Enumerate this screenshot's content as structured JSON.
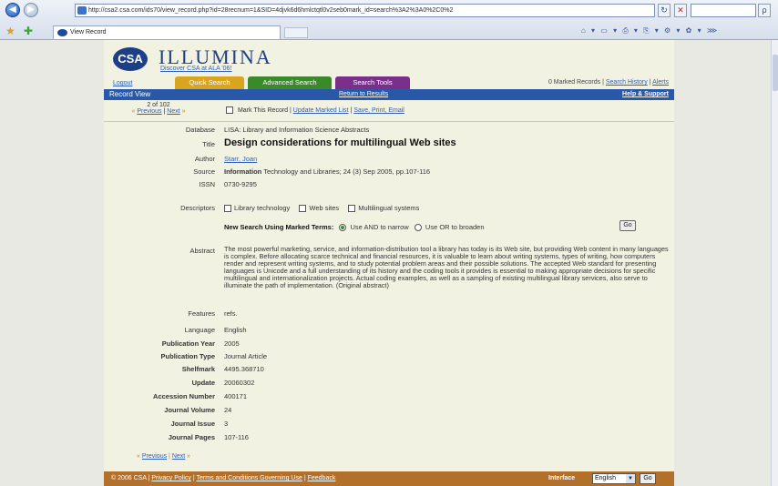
{
  "browser": {
    "url": "http://csa2.csa.com/ids70/view_record.php?id=28recnum=1&SID=4djvk6d6hmlctqtl0v2seb0mark_id=search%3A2%3A0%2C0%2",
    "tab_title": "View Record",
    "back_label": "◀",
    "forward_label": "▶",
    "go_label": "↻",
    "stop_label": "✕",
    "search_label": "ρ",
    "toolbar_icons": "⌂ ▾ ▭ ▾ ⎙ ▾ ⎘ ▾ ⚙ ▾ ✿ ▾ ⋙"
  },
  "header": {
    "logo": "CSA",
    "brand": "ILLUMINA",
    "discover": "Discover CSA at ALA '06!"
  },
  "nav": {
    "logout": "Logout",
    "tabs": [
      {
        "label": "Quick Search",
        "color": "#d9a520"
      },
      {
        "label": "Advanced Search",
        "color": "#3a8a2a"
      },
      {
        "label": "Search Tools",
        "color": "#7a2f8a"
      }
    ],
    "marked": "0 Marked Records",
    "history": "Search History",
    "alerts": "Alerts"
  },
  "bar": {
    "record_view": "Record View",
    "return": "Return to Results",
    "help": "Help & Support"
  },
  "record_nav": {
    "count": "2 of 102",
    "previous": "Previous",
    "next": "Next",
    "mark_label": "Mark This Record",
    "update_marked": "Update Marked List",
    "save_print": "Save, Print, Email"
  },
  "fields": {
    "database_label": "Database",
    "database": "LISA: Library and Information Science Abstracts",
    "title_label": "Title",
    "title": "Design considerations for multilingual Web sites",
    "author_label": "Author",
    "author": "Starr, Joan",
    "source_label": "Source",
    "source_em": "Information",
    "source": "Technology and Libraries; 24 (3) Sep 2005, pp.107-116",
    "issn_label": "ISSN",
    "issn": "0730-9295",
    "descriptors_label": "Descriptors",
    "descriptors": [
      "Library technology",
      "Web sites",
      "Multilingual systems"
    ],
    "new_search_label": "New Search Using Marked Terms:",
    "and_label": "Use AND to narrow",
    "or_label": "Use OR to broaden",
    "go": "Go",
    "abstract_label": "Abstract",
    "abstract": "The most powerful marketing, service, and information-distribution tool a library has today is its Web site, but providing Web content in many languages is complex. Before allocating scarce technical and financial resources, it is valuable to learn about writing systems, types of writing, how computers render and represent writing systems, and to study potential problem areas and their possible solutions. The accepted Web standard for presenting languages is Unicode and a full understanding of its history and the coding tools it provides is essential to making appropriate decisions for specific multilingual and internationalization projects. Actual coding examples, as well as a sampling of existing multilingual library services, also serve to illuminate the path of implementation. (Original abstract)",
    "features_label": "Features",
    "features": "refs.",
    "language_label": "Language",
    "language": "English",
    "pubyear_label": "Publication Year",
    "pubyear": "2005",
    "pubtype_label": "Publication Type",
    "pubtype": "Journal Article",
    "shelfmark_label": "Shelfmark",
    "shelfmark": "4495.368710",
    "update_label": "Update",
    "update": "20060302",
    "accession_label": "Accession Number",
    "accession": "400171",
    "volume_label": "Journal Volume",
    "volume": "24",
    "issue_label": "Journal Issue",
    "issue": "3",
    "pages_label": "Journal Pages",
    "pages": "107-116"
  },
  "footer": {
    "copyright": "© 2006 CSA",
    "privacy": "Privacy Policy",
    "terms": "Terms and Conditions Governing Use",
    "feedback": "Feedback",
    "interface_label": "Interface",
    "interface_value": "English",
    "go": "Go"
  }
}
